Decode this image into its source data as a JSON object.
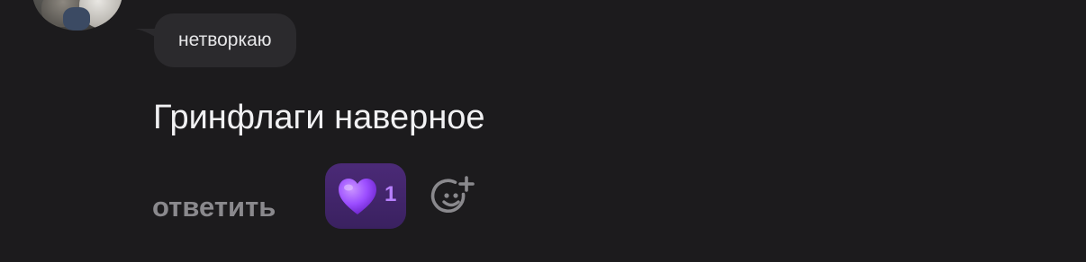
{
  "comment": {
    "reply_to_text": "нетворкаю",
    "message": "Гринфлаги наверное",
    "reply_label": "ответить"
  },
  "reactions": [
    {
      "icon": "purple-heart-icon",
      "count": "1",
      "color": "#9b4dff"
    }
  ],
  "actions": {
    "add_reaction_icon": "add-reaction-smiley-icon"
  },
  "colors": {
    "background": "#1c1b1d",
    "bubble": "#2b2a2d",
    "reaction_chip": "#3f2468",
    "accent": "#b880ff",
    "muted_text": "#8a898d"
  }
}
